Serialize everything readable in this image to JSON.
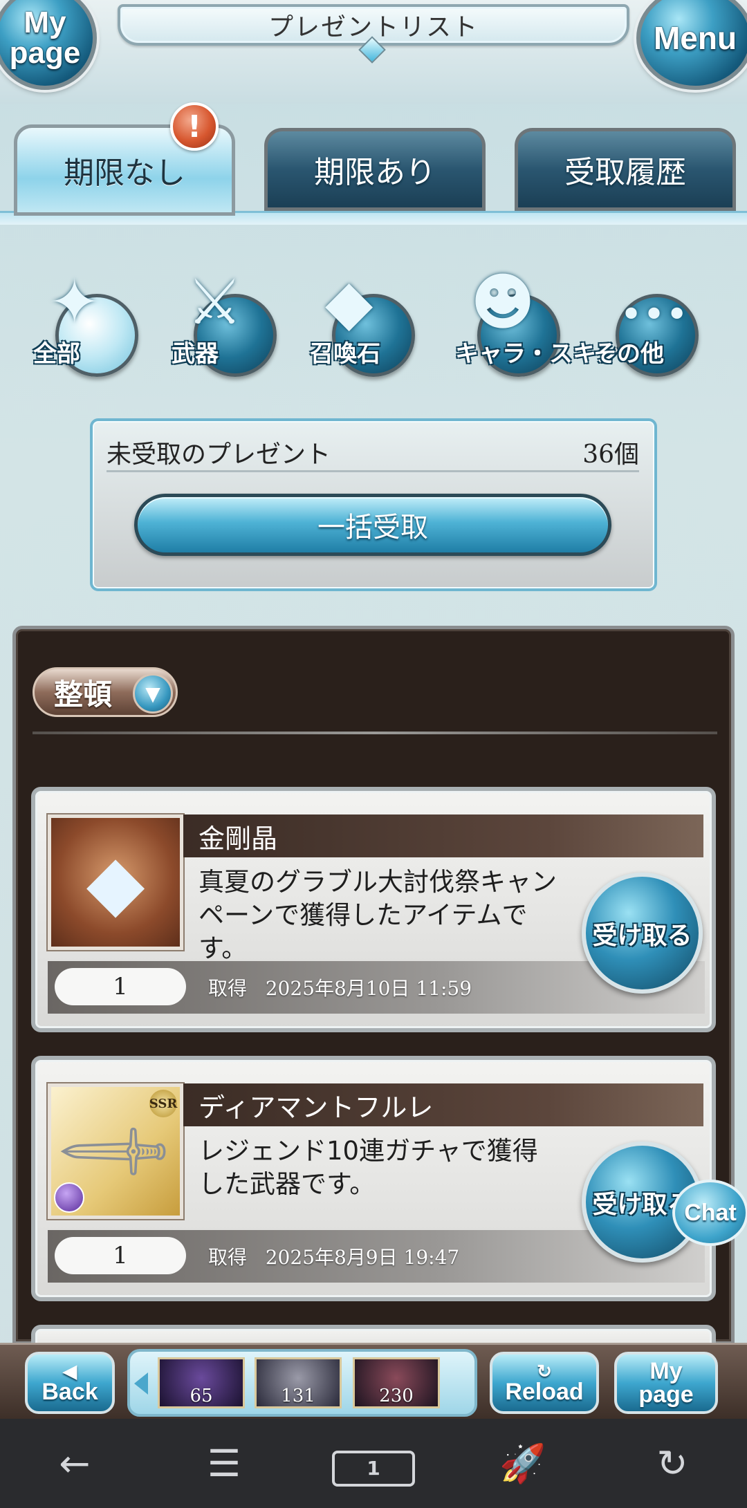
{
  "header": {
    "title": "プレゼントリスト",
    "mypage_label": "My\npage",
    "menu_label": "Menu"
  },
  "tabs": [
    {
      "label": "期限なし",
      "active": true,
      "has_alert": true
    },
    {
      "label": "期限あり",
      "active": false
    },
    {
      "label": "受取履歴",
      "active": false
    }
  ],
  "alert_badge": "!",
  "categories": [
    {
      "label": "全部",
      "icon": "all-icon",
      "active": true
    },
    {
      "label": "武器",
      "icon": "sword-icon",
      "active": false
    },
    {
      "label": "召喚石",
      "icon": "crystal-icon",
      "active": false
    },
    {
      "label": "キャラ・スキン",
      "icon": "character-icon",
      "active": false
    },
    {
      "label": "その他",
      "icon": "more-icon",
      "active": false
    }
  ],
  "unclaimed": {
    "label": "未受取のプレゼント",
    "count": "36個",
    "bulk_button": "一括受取"
  },
  "sort": {
    "label": "整頓"
  },
  "presents": [
    {
      "name": "金剛晶",
      "description": "真夏のグラブル大討伐祭キャンペーンで獲得したアイテムです。",
      "quantity": "1",
      "obtained_label": "取得",
      "date": "2025年8月10日 11:59",
      "button": "受け取る",
      "icon": "crystal-item-icon"
    },
    {
      "name": "ディアマントフルレ",
      "description": "レジェンド10連ガチャで獲得した武器です。",
      "quantity": "1",
      "obtained_label": "取得",
      "date": "2025年8月9日 19:47",
      "button": "受け取る",
      "icon": "sword-item-icon",
      "rarity": "SSR"
    }
  ],
  "chat_label": "Chat",
  "bottom_nav": {
    "back": "Back",
    "reload": "Reload",
    "mypage": "My\npage",
    "quests": [
      "65",
      "131",
      "230"
    ]
  },
  "colors": {
    "accent_blue": "#2f8fb8",
    "panel_dark": "#2a201b",
    "alert_red": "#d7572f"
  }
}
